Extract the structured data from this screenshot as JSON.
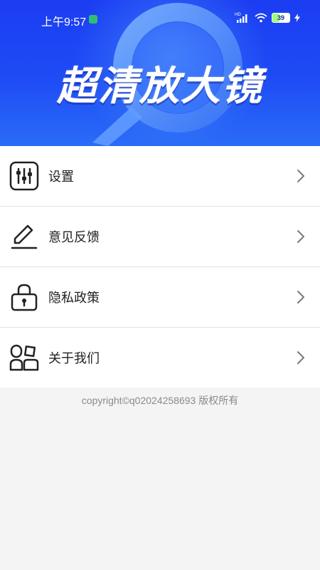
{
  "status_bar": {
    "time": "上午9:57",
    "battery_level": "39",
    "network_label": "HD"
  },
  "banner": {
    "title": "超清放大镜"
  },
  "menu": {
    "items": [
      {
        "label": "设置",
        "icon": "settings-sliders-icon"
      },
      {
        "label": "意见反馈",
        "icon": "pen-feedback-icon"
      },
      {
        "label": "隐私政策",
        "icon": "lock-icon"
      },
      {
        "label": "关于我们",
        "icon": "people-icon"
      }
    ]
  },
  "footer": {
    "copyright": "copyright©q02024258693 版权所有"
  },
  "colors": {
    "banner_blue": "#1f4cf5",
    "text": "#222222",
    "muted": "#8a8a8a"
  }
}
